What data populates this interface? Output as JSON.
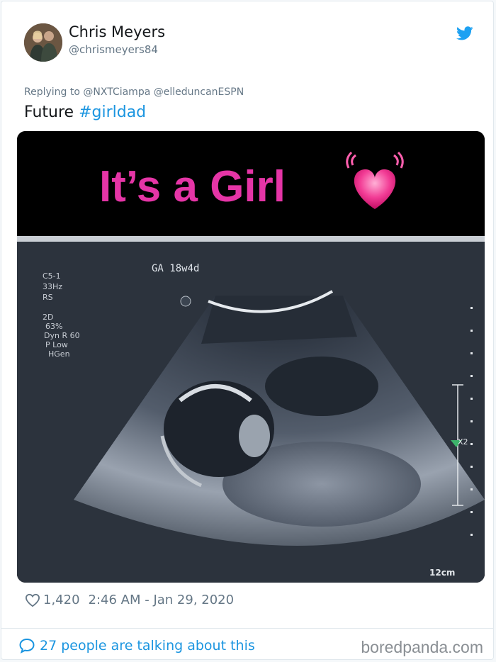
{
  "author": {
    "name": "Chris Meyers",
    "handle": "@chrismeyers84"
  },
  "reply": {
    "prefix": "Replying to",
    "mentions": "@NXTCiampa @elleduncanESPN"
  },
  "tweet": {
    "text": "Future",
    "hashtag": "#girldad"
  },
  "media": {
    "banner_text": "It’s a Girl",
    "banner_icon": "beating-heart-icon",
    "scan": {
      "ga_label": "GA 18w4d",
      "probe_info": [
        "C5-1",
        "33Hz",
        "RS",
        "2D",
        "63%",
        "Dyn R 60",
        "P Low",
        "HGen"
      ],
      "marker_label": "X2",
      "depth_label": "12cm"
    }
  },
  "engagement": {
    "likes": "1,420",
    "timestamp": "2:46 AM - Jan 29, 2020"
  },
  "footer": {
    "talking": "27 people are talking about this",
    "brand": "boredpanda.com"
  },
  "colors": {
    "link": "#1b95e0",
    "banner_pink": "#e535a6"
  }
}
